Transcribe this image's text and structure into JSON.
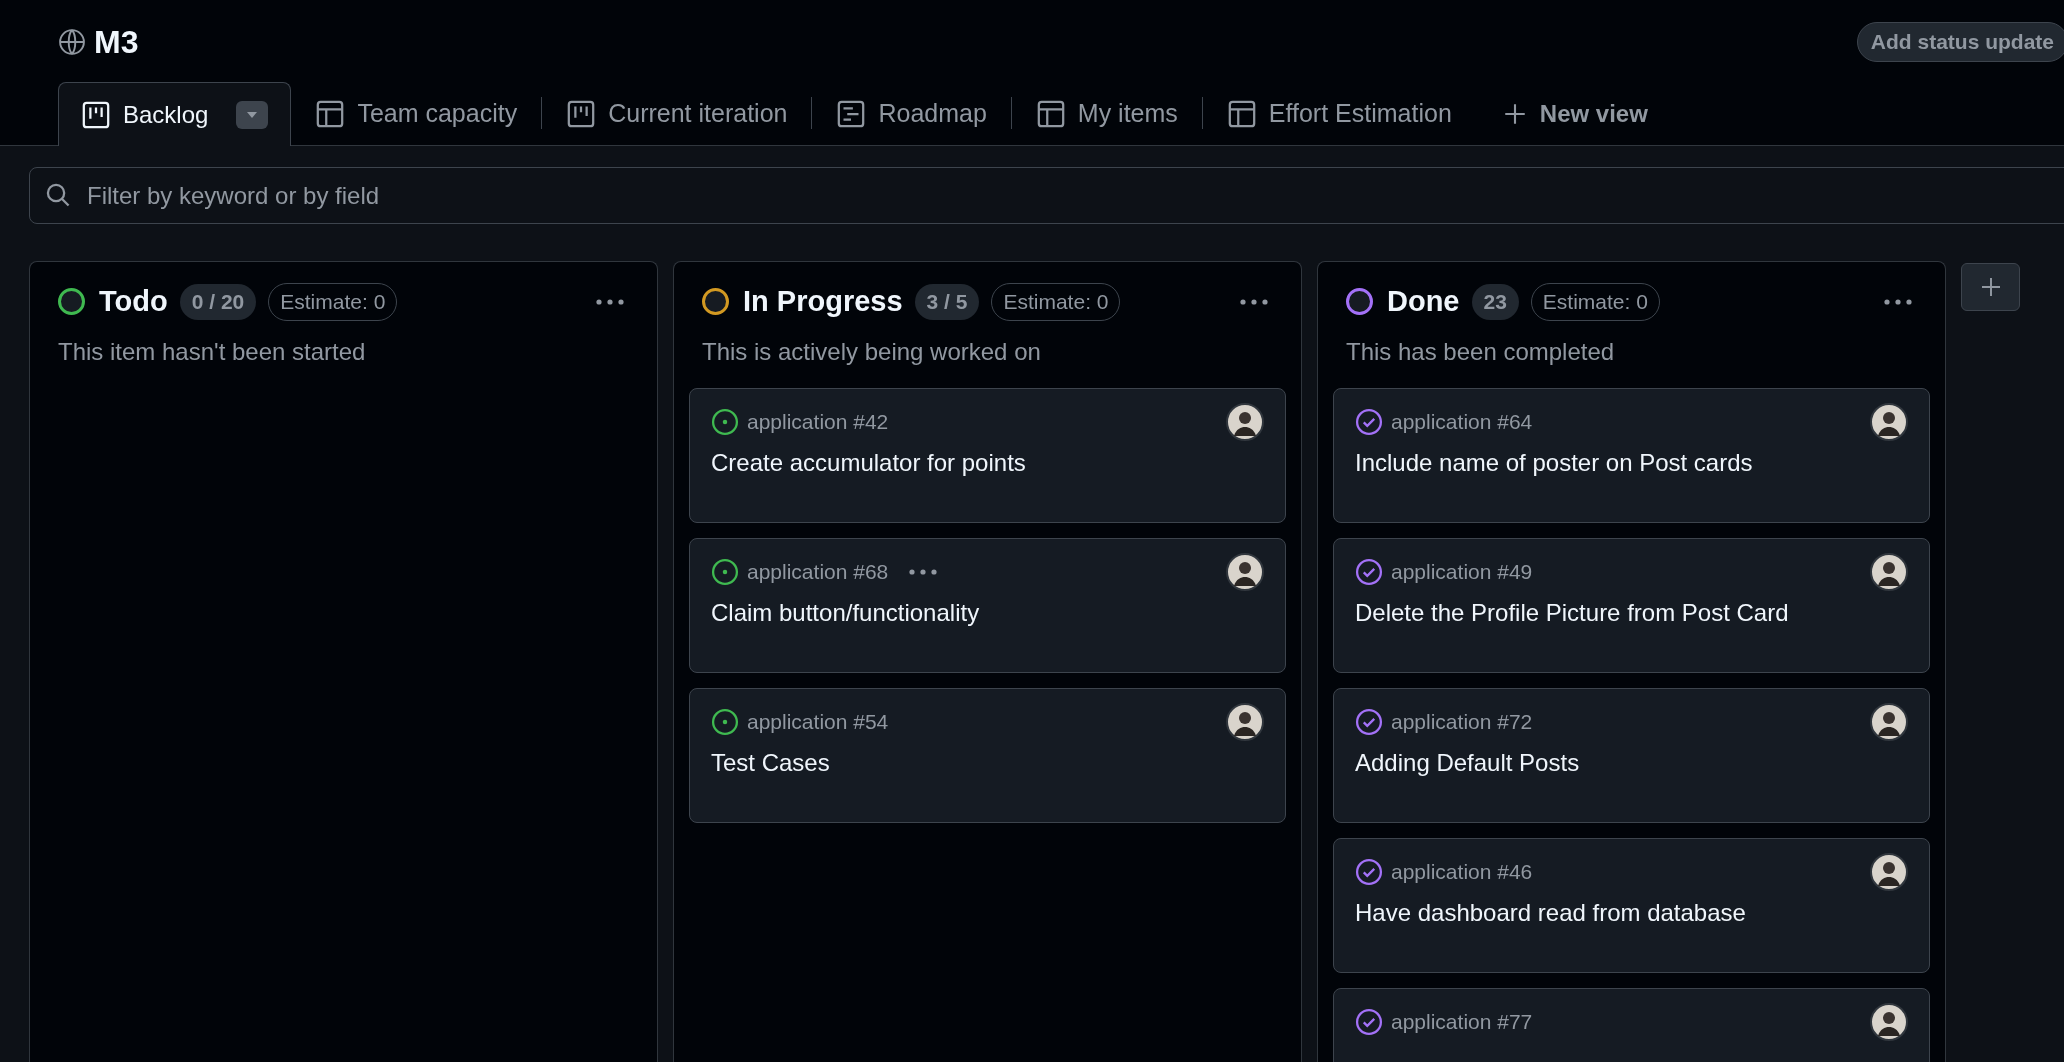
{
  "project": {
    "title": "M3",
    "status_button": "Add status update"
  },
  "tabs": [
    {
      "label": "Backlog",
      "kind": "board",
      "selected": true
    },
    {
      "label": "Team capacity",
      "kind": "table",
      "selected": false
    },
    {
      "label": "Current iteration",
      "kind": "board",
      "selected": false
    },
    {
      "label": "Roadmap",
      "kind": "roadmap",
      "selected": false
    },
    {
      "label": "My items",
      "kind": "table",
      "selected": false
    },
    {
      "label": "Effort Estimation",
      "kind": "table",
      "selected": false
    }
  ],
  "new_view": "New view",
  "filter": {
    "placeholder": "Filter by keyword or by field"
  },
  "columns": [
    {
      "name": "Todo",
      "color": "#3fb950",
      "count": "0 / 20",
      "estimate": "Estimate: 0",
      "description": "This item hasn't been started"
    },
    {
      "name": "In Progress",
      "color": "#d29922",
      "count": "3 / 5",
      "estimate": "Estimate: 0",
      "description": "This is actively being worked on",
      "cards": [
        {
          "ref": "application #42",
          "title": "Create accumulator for points",
          "kind": "open",
          "menu_visible": false
        },
        {
          "ref": "application #68",
          "title": "Claim button/functionality",
          "kind": "open",
          "menu_visible": true
        },
        {
          "ref": "application #54",
          "title": "Test Cases",
          "kind": "open",
          "menu_visible": false
        }
      ]
    },
    {
      "name": "Done",
      "color": "#a371f7",
      "count": "23",
      "estimate": "Estimate: 0",
      "description": "This has been completed",
      "cards": [
        {
          "ref": "application #64",
          "title": "Include name of poster on Post cards",
          "kind": "closed",
          "menu_visible": false
        },
        {
          "ref": "application #49",
          "title": "Delete the Profile Picture from Post Card",
          "kind": "closed",
          "menu_visible": false
        },
        {
          "ref": "application #72",
          "title": "Adding Default Posts",
          "kind": "closed",
          "menu_visible": false
        },
        {
          "ref": "application #46",
          "title": "Have dashboard read from database",
          "kind": "closed",
          "menu_visible": false
        },
        {
          "ref": "application #77",
          "kind": "closed",
          "menu_visible": false
        }
      ]
    }
  ]
}
